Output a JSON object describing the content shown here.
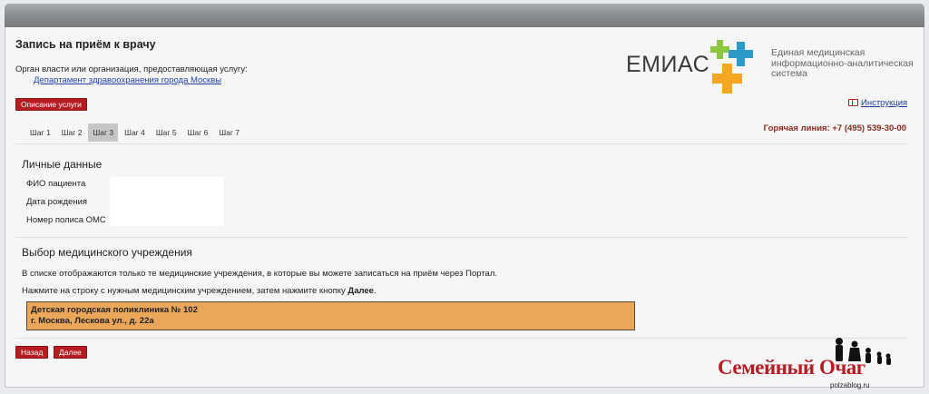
{
  "header": {
    "title": "Запись на приём к врачу",
    "org_label": "Орган власти или организация, предоставляющая услугу:",
    "org_link": "Департамент здравоохранения города Москвы",
    "service_description_button": "Описание услуги"
  },
  "logo": {
    "name": "ЕМИАС",
    "subtitle_lines": [
      "Единая медицинская",
      "информационно-аналитическая",
      "система"
    ],
    "colors": {
      "green": "#8cc63e",
      "blue": "#2d9bc9",
      "orange": "#f5a623"
    }
  },
  "instruction_link": "Инструкция",
  "hotline": "Горячая линия: +7 (495) 539-30-00",
  "steps": {
    "items": [
      "Шаг 1",
      "Шаг 2",
      "Шаг 3",
      "Шаг 4",
      "Шаг 5",
      "Шаг 6",
      "Шаг 7"
    ],
    "active": "Шаг 3"
  },
  "personal_data": {
    "heading": "Личные данные",
    "fields": [
      "ФИО пациента",
      "Дата рождения",
      "Номер полиса ОМС"
    ]
  },
  "institution": {
    "heading": "Выбор медицинского учреждения",
    "note": "В списке отображаются только те медицинские учреждения, в которые вы можете записаться на приём через Портал.",
    "instruction_prefix": "Нажмите на строку с нужным медицинским учреждением, затем нажмите кнопку ",
    "instruction_button_ref": "Далее",
    "instruction_suffix": ".",
    "clinic": {
      "name": "Детская городская поликлиника № 102",
      "address": "г. Москва, Лескова ул., д. 22а"
    }
  },
  "nav": {
    "back": "Назад",
    "next": "Далее"
  },
  "watermark": {
    "text": "Семейный Очаг",
    "site": "polzablog.ru"
  },
  "accent_color": "#b51d23"
}
